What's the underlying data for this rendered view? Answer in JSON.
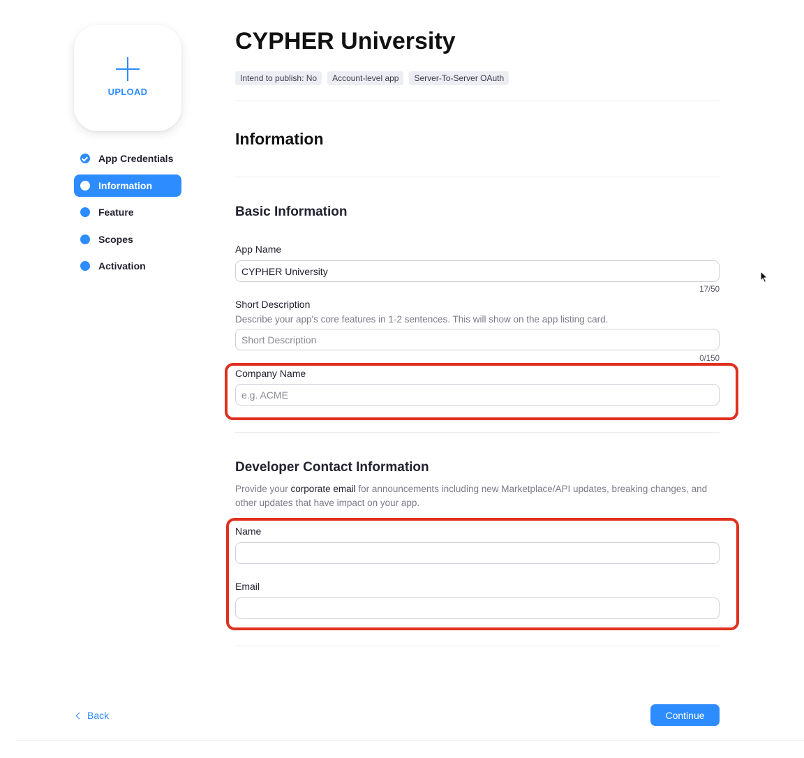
{
  "upload": {
    "label": "UPLOAD",
    "icon": "plus-icon"
  },
  "nav": {
    "items": [
      {
        "label": "App Credentials",
        "state": "completed"
      },
      {
        "label": "Information",
        "state": "active"
      },
      {
        "label": "Feature",
        "state": "pending"
      },
      {
        "label": "Scopes",
        "state": "pending"
      },
      {
        "label": "Activation",
        "state": "pending"
      }
    ]
  },
  "header": {
    "title": "CYPHER University",
    "tags": [
      "Intend to publish: No",
      "Account-level app",
      "Server-To-Server OAuth"
    ]
  },
  "page": {
    "section_title": "Information"
  },
  "basic_info": {
    "title": "Basic Information",
    "app_name": {
      "label": "App Name",
      "value": "CYPHER University",
      "counter": "17/50"
    },
    "short_description": {
      "label": "Short Description",
      "hint": "Describe your app's core features in 1-2 sentences. This will show on the app listing card.",
      "placeholder": "Short Description",
      "value": "",
      "counter": "0/150"
    },
    "company_name": {
      "label": "Company Name",
      "placeholder": "e.g. ACME",
      "value": ""
    }
  },
  "developer_contact": {
    "title": "Developer Contact Information",
    "hint_prefix": "Provide your ",
    "hint_emphasis": "corporate email",
    "hint_suffix": " for announcements including new Marketplace/API updates, breaking changes, and other updates that have impact on your app.",
    "name": {
      "label": "Name",
      "value": ""
    },
    "email": {
      "label": "Email",
      "value": ""
    }
  },
  "footer": {
    "back_label": "Back",
    "continue_label": "Continue"
  },
  "colors": {
    "accent": "#2d8cff",
    "highlight": "#e0301e"
  }
}
